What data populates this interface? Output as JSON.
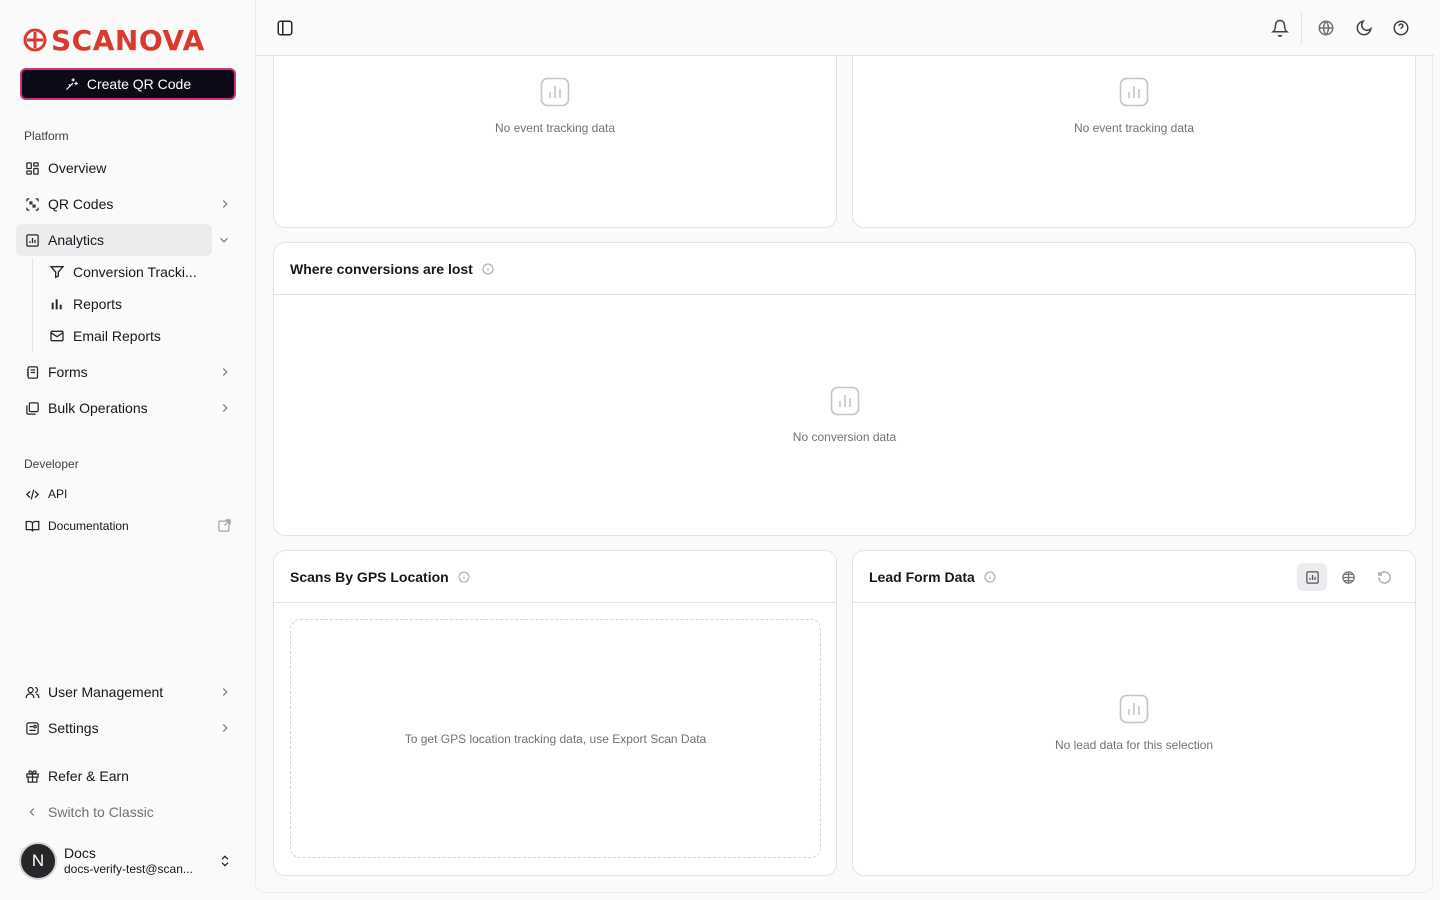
{
  "brand": {
    "name": "SCANOVA",
    "color": "#d83a2e"
  },
  "sidebar": {
    "create_button": "Create QR Code",
    "platform_label": "Platform",
    "items": [
      {
        "label": "Overview",
        "icon": "grid-icon"
      },
      {
        "label": "QR Codes",
        "icon": "qr-scan-icon"
      },
      {
        "label": "Analytics",
        "icon": "bar-chart-icon"
      },
      {
        "label": "Forms",
        "icon": "form-icon"
      },
      {
        "label": "Bulk Operations",
        "icon": "boxes-icon"
      }
    ],
    "analytics_sub": [
      {
        "label": "Conversion Tracki...",
        "icon": "funnel-icon"
      },
      {
        "label": "Reports",
        "icon": "bars-icon"
      },
      {
        "label": "Email Reports",
        "icon": "mail-icon"
      }
    ],
    "developer_label": "Developer",
    "developer_items": [
      {
        "label": "API",
        "icon": "code-icon"
      },
      {
        "label": "Documentation",
        "icon": "book-icon"
      }
    ],
    "bottom_items": [
      {
        "label": "User Management",
        "icon": "users-icon"
      },
      {
        "label": "Settings",
        "icon": "settings-icon"
      },
      {
        "label": "Refer & Earn",
        "icon": "gift-icon"
      },
      {
        "label": "Switch to Classic",
        "icon": "chevron-left-icon"
      }
    ],
    "user": {
      "initial": "N",
      "name": "Docs",
      "email": "docs-verify-test@scan..."
    }
  },
  "cards": {
    "top_left": {
      "empty": "No event tracking data"
    },
    "top_right": {
      "empty": "No event tracking data"
    },
    "conversions": {
      "title": "Where conversions are lost",
      "empty": "No conversion data"
    },
    "gps": {
      "title": "Scans By GPS Location",
      "empty": "To get GPS location tracking data, use Export Scan Data"
    },
    "lead": {
      "title": "Lead Form Data",
      "empty": "No lead data for this selection"
    }
  }
}
